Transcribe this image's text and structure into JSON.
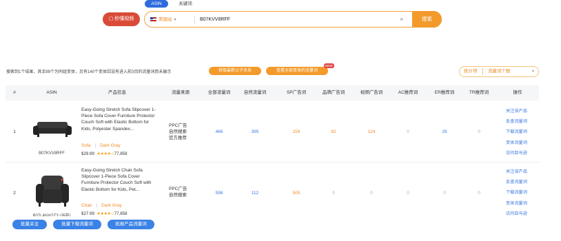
{
  "mode_tabs": [
    "ASIN",
    "关键词"
  ],
  "search": {
    "video_button_label": "▢ 秒懂视频",
    "site_label": "美国站",
    "value": "B07KVV8RFF",
    "submit_label": "搜索"
  },
  "info_text": "搜索到1个结果，其余99个为同组变体，另有140个变体因没有进入前3页的流量词而未展示",
  "buttons": {
    "get_latest": "获取最新父子关系",
    "view_all": "查看全部变体的流量词",
    "new_badge": "NEW"
  },
  "stat_select": {
    "label": "统计项",
    "value": "流量词个数"
  },
  "table": {
    "headers": [
      "#",
      "ASIN",
      "产品信息",
      "流量来源",
      "全部流量词",
      "自然流量词",
      "SP广告词",
      "品牌广告词",
      "视频广告词",
      "AC推荐词",
      "ER推荐词",
      "TR推荐词",
      "操作"
    ],
    "rows": [
      {
        "index": "1",
        "asin": "B07KVV8RFF",
        "title": "Easy-Going Stretch Sofa Slipcover 1-Piece Sofa Cover Furniture Protector Couch Soft with Elastic Bottom for Kids, Polyester Spandex...",
        "attr1": "Sofa",
        "attr2": "Dark Gray",
        "price": "$29.99",
        "stars": "★★★★☆",
        "reviews": "77,858",
        "source": "PPC广告\n自然搜索\n官方推荐",
        "counts": [
          "466",
          "395",
          "159",
          "82",
          "124",
          "0",
          "28",
          "0"
        ],
        "actions": [
          "关注该产品",
          "反查流量词",
          "下载流量词",
          "变体流量词",
          "访问亚马逊"
        ]
      },
      {
        "index": "2",
        "asin": "B07L4NXGT3 (当前)",
        "title": "Easy-Going Stretch Chair Sofa Slipcover 1-Piece Sofa Cover Furniture Protector Couch Soft with Elastic Bottom for Kids, Pet...",
        "attr1": "Chair",
        "attr2": "Dark Gray",
        "price": "$27.99",
        "stars": "★★★★☆",
        "reviews": "77,858",
        "source": "PPC广告\n自然搜索",
        "counts": [
          "598",
          "112",
          "505",
          "0",
          "0",
          "0",
          "0",
          "0"
        ],
        "actions": [
          "关注该产品",
          "反查流量词",
          "下载流量词",
          "变体流量词",
          "访问亚马逊"
        ]
      }
    ]
  },
  "bottom_buttons": [
    "批量关注",
    "批量下载流量词",
    "拓展产品流量词"
  ],
  "colors": {
    "accent_orange": "#f39a2b",
    "brand_blue": "#2f6bdc",
    "video_red": "#d94a38",
    "link_blue": "#3b7ae0"
  }
}
